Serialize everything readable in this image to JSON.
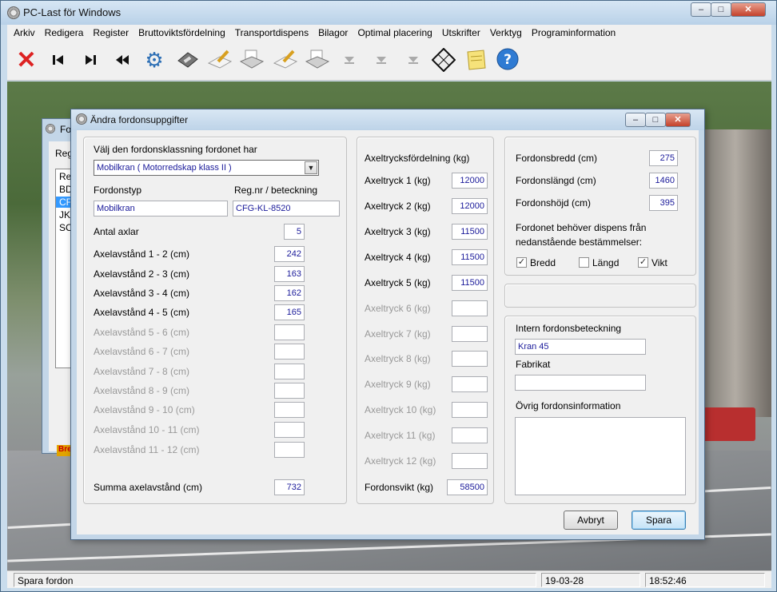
{
  "window": {
    "title": "PC-Last för Windows",
    "menu": [
      "Arkiv",
      "Redigera",
      "Register",
      "Bruttoviktsfördelning",
      "Transportdispens",
      "Bilagor",
      "Optimal placering",
      "Utskrifter",
      "Verktyg",
      "Programinformation"
    ],
    "min": "–",
    "max": "□",
    "close": "✕"
  },
  "toolbar": {
    "icons": [
      "delete-icon",
      "first-record-icon",
      "next-record-icon",
      "rewind-icon",
      "settings-gears-icon",
      "save-disk-icon",
      "edit-pen-icon",
      "print-icon",
      "edit-pen-icon",
      "print-icon",
      "arrow-down-icon",
      "arrow-down-icon",
      "arrow-down-icon",
      "calculator-icon",
      "notes-icon",
      "help-icon"
    ]
  },
  "status": {
    "message": "Spara fordon",
    "date": "19-03-28",
    "time": "18:52:46"
  },
  "bg_dialog": {
    "title": "Fo",
    "label": "Reg",
    "list_header": "Re",
    "items": [
      "BD",
      "CF",
      "JK",
      "SC"
    ],
    "badge": "Bre"
  },
  "dialog": {
    "title": "Ändra fordonsuppgifter",
    "classification_label": "Välj den fordonsklassning fordonet har",
    "classification_value": "Mobilkran ( Motorredskap klass II )",
    "vehicle_type_label": "Fordonstyp",
    "vehicle_type_value": "Mobilkran",
    "regnr_label": "Reg.nr / beteckning",
    "regnr_value": "CFG-KL-8520",
    "axles_label": "Antal axlar",
    "axles_value": "5",
    "axle_spacings": [
      {
        "label": "Axelavstånd   1 - 2  (cm)",
        "value": "242"
      },
      {
        "label": "Axelavstånd   2 - 3  (cm)",
        "value": "163"
      },
      {
        "label": "Axelavstånd   3 - 4  (cm)",
        "value": "162"
      },
      {
        "label": "Axelavstånd   4 - 5  (cm)",
        "value": "165"
      },
      {
        "label": "Axelavstånd   5 - 6  (cm)",
        "value": ""
      },
      {
        "label": "Axelavstånd   6 - 7  (cm)",
        "value": ""
      },
      {
        "label": "Axelavstånd   7 - 8  (cm)",
        "value": ""
      },
      {
        "label": "Axelavstånd   8 - 9  (cm)",
        "value": ""
      },
      {
        "label": "Axelavstånd   9 - 10  (cm)",
        "value": ""
      },
      {
        "label": "Axelavstånd   10 - 11 (cm)",
        "value": ""
      },
      {
        "label": "Axelavstånd   11 - 12 (cm)",
        "value": ""
      }
    ],
    "sum_label": "Summa axelavstånd (cm)",
    "sum_value": "732",
    "axle_load_title": "Axeltrycksfördelning (kg)",
    "axle_loads": [
      {
        "label": "Axeltryck 1 (kg)",
        "value": "12000"
      },
      {
        "label": "Axeltryck 2 (kg)",
        "value": "12000"
      },
      {
        "label": "Axeltryck 3 (kg)",
        "value": "11500"
      },
      {
        "label": "Axeltryck 4 (kg)",
        "value": "11500"
      },
      {
        "label": "Axeltryck 5 (kg)",
        "value": "11500"
      },
      {
        "label": "Axeltryck 6 (kg)",
        "value": ""
      },
      {
        "label": "Axeltryck 7 (kg)",
        "value": ""
      },
      {
        "label": "Axeltryck 8 (kg)",
        "value": ""
      },
      {
        "label": "Axeltryck 9 (kg)",
        "value": ""
      },
      {
        "label": "Axeltryck 10 (kg)",
        "value": ""
      },
      {
        "label": "Axeltryck 11 (kg)",
        "value": ""
      },
      {
        "label": "Axeltryck 12 (kg)",
        "value": ""
      }
    ],
    "weight_label": "Fordonsvikt (kg)",
    "weight_value": "58500",
    "width_label": "Fordonsbredd (cm)",
    "width_value": "275",
    "length_label": "Fordonslängd (cm)",
    "length_value": "1460",
    "height_label": "Fordonshöjd (cm)",
    "height_value": "395",
    "dispens_text_1": "Fordonet behöver dispens från",
    "dispens_text_2": "nedanstående bestämmelser:",
    "check_width": {
      "label": "Bredd",
      "checked": true
    },
    "check_length": {
      "label": "Längd",
      "checked": false
    },
    "check_weight": {
      "label": "Vikt",
      "checked": true
    },
    "internal_label": "Intern fordonsbeteckning",
    "internal_value": "Kran 45",
    "brand_label": "Fabrikat",
    "brand_value": "",
    "info_label": "Övrig fordonsinformation",
    "info_value": "",
    "cancel_label": "Avbryt",
    "save_label": "Spara"
  }
}
